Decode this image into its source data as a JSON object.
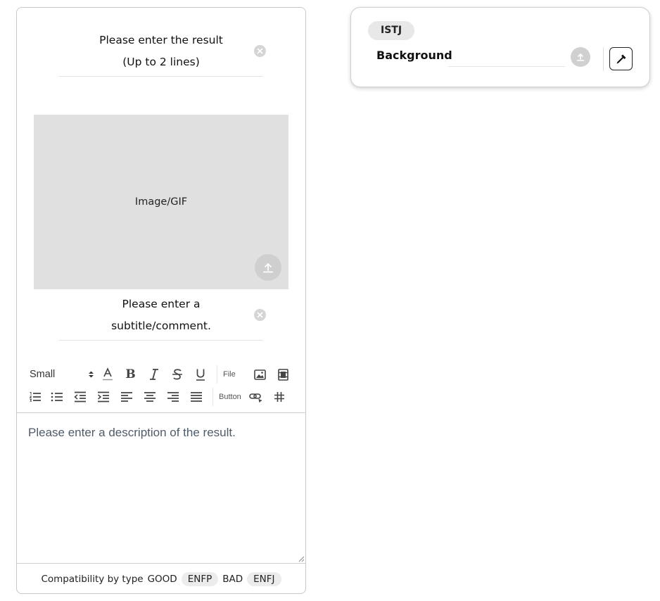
{
  "result_editor": {
    "title_placeholder_line1": "Please enter the result",
    "title_placeholder_line2": "(Up to 2 lines)",
    "image_label": "Image/GIF",
    "subtitle_placeholder_line1": "Please enter a",
    "subtitle_placeholder_line2": "subtitle/comment.",
    "toolbar": {
      "font_size_value": "Small",
      "file_label": "File",
      "button_label": "Button"
    },
    "description_placeholder": "Please enter a description of the result.",
    "compatibility": {
      "label": "Compatibility by type",
      "good_label": "GOOD",
      "good_type": "ENFP",
      "bad_label": "BAD",
      "bad_type": "ENFJ"
    }
  },
  "background_panel": {
    "type_tag": "ISTJ",
    "label": "Background",
    "input_value": ""
  },
  "icons": {
    "clear": "clear-icon",
    "upload": "upload-icon",
    "color_picker": "eyedropper-icon"
  },
  "colors": {
    "image_placeholder_bg": "#e0e0e0",
    "pill_bg": "#ececec",
    "placeholder_text": "#4f5b6a"
  }
}
